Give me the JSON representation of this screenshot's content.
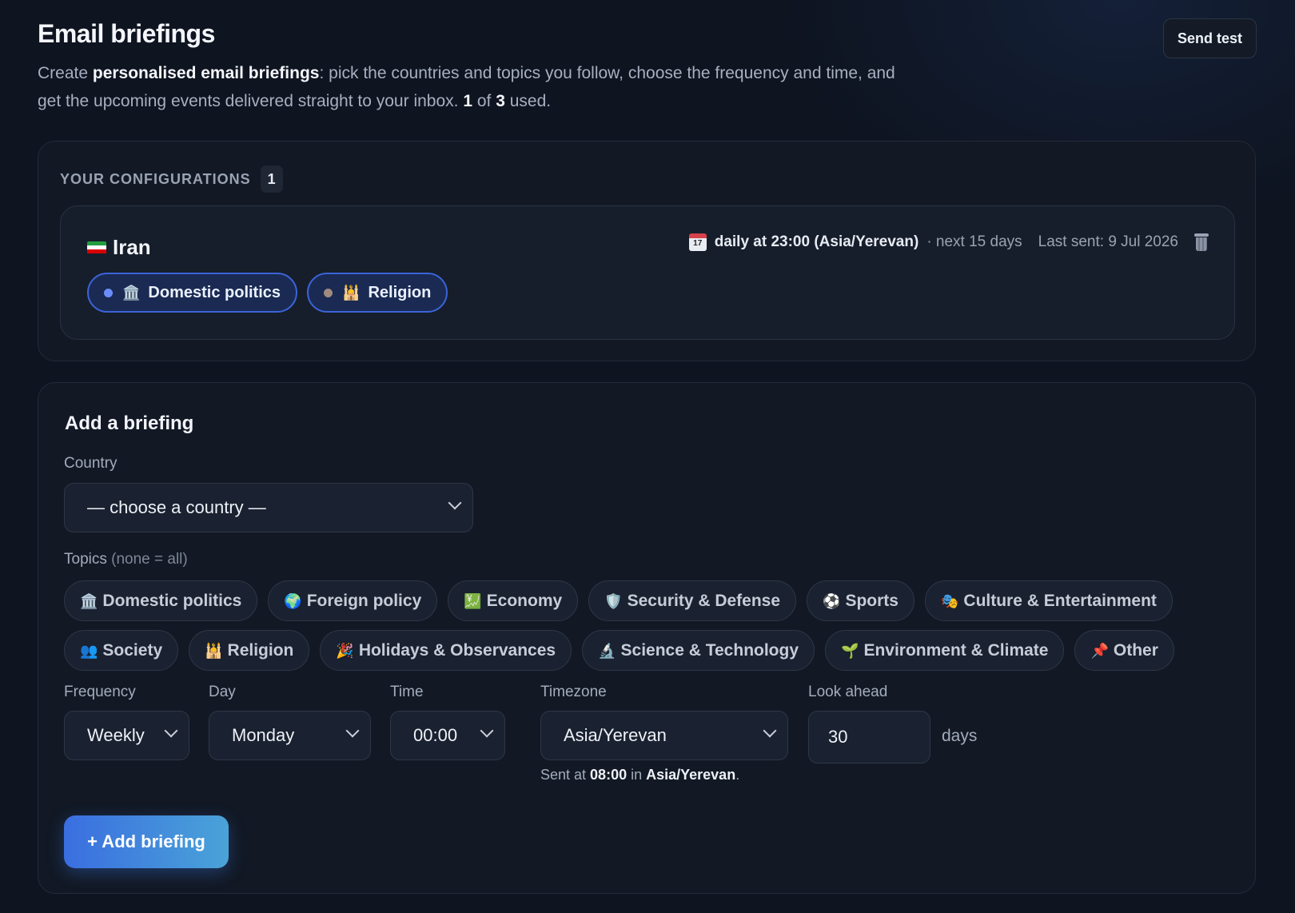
{
  "header": {
    "title": "Email briefings",
    "desc_pre": "Create ",
    "desc_bold": "personalised email briefings",
    "desc_mid": ": pick the countries and topics you follow, choose the frequency and time, and get the upcoming events delivered straight to your inbox. ",
    "used_count": "1",
    "of_text": " of ",
    "used_limit": "3",
    "used_suffix": " used.",
    "send_test_label": "Send test"
  },
  "configurations": {
    "label": "YOUR CONFIGURATIONS",
    "count": "1",
    "items": [
      {
        "country": "Iran",
        "schedule": "daily at 23:00 (Asia/Yerevan)",
        "lookahead": "· next 15 days",
        "last_sent": "Last sent: 9 Jul 2026",
        "topics": [
          {
            "label": "Domestic politics",
            "emoji": "🏛️",
            "dot_color": "#6b8cff"
          },
          {
            "label": "Religion",
            "emoji": "🕌",
            "dot_color": "#a08a80"
          }
        ]
      }
    ]
  },
  "add_briefing": {
    "title": "Add a briefing",
    "country_label": "Country",
    "country_placeholder": "— choose a country —",
    "topics_label": "Topics",
    "topics_hint": "(none = all)",
    "topics_row1": [
      {
        "label": "Domestic politics",
        "emoji": "🏛️"
      },
      {
        "label": "Foreign policy",
        "emoji": "🌍"
      },
      {
        "label": "Economy",
        "emoji": "💹"
      },
      {
        "label": "Security & Defense",
        "emoji": "🛡️"
      },
      {
        "label": "Sports",
        "emoji": "⚽"
      },
      {
        "label": "Culture & Entertainment",
        "emoji": "🎭"
      }
    ],
    "topics_row2": [
      {
        "label": "Society",
        "emoji": "👥"
      },
      {
        "label": "Religion",
        "emoji": "🕌"
      },
      {
        "label": "Holidays & Observances",
        "emoji": "🎉"
      },
      {
        "label": "Science & Technology",
        "emoji": "🔬"
      },
      {
        "label": "Environment & Climate",
        "emoji": "🌱"
      },
      {
        "label": "Other",
        "emoji": "📌"
      }
    ],
    "frequency_label": "Frequency",
    "frequency_value": "Weekly",
    "day_label": "Day",
    "day_value": "Monday",
    "time_label": "Time",
    "time_value": "00:00",
    "timezone_label": "Timezone",
    "timezone_value": "Asia/Yerevan",
    "lookahead_label": "Look ahead",
    "lookahead_value": "30",
    "lookahead_unit": "days",
    "sent_note_pre": "Sent at ",
    "sent_note_time": "08:00",
    "sent_note_mid": " in ",
    "sent_note_tz": "Asia/Yerevan",
    "sent_note_end": ".",
    "add_button_label": "+ Add briefing"
  },
  "colors": {
    "accent": "#3a6ee0",
    "background": "#0e1420",
    "card": "#121925"
  }
}
